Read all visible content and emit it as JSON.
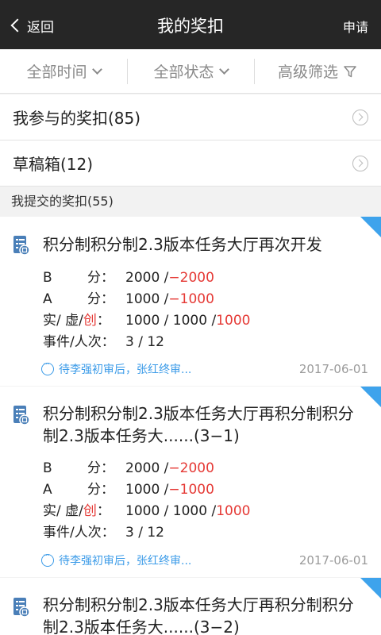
{
  "header": {
    "back_label": "返回",
    "title": "我的奖扣",
    "action_label": "申请"
  },
  "filters": [
    {
      "label": "全部时间"
    },
    {
      "label": "全部状态"
    },
    {
      "label": "高级筛选"
    }
  ],
  "rows": [
    {
      "label": "我参与的奖扣(85)"
    },
    {
      "label": "草稿箱(12)"
    }
  ],
  "section_title": "我提交的奖扣(55)",
  "cards": [
    {
      "title": "积分制积分制2.3版本任务大厅再次开发",
      "b_label": "B",
      "b_unit": "分：",
      "b_value": "2000 / ",
      "b_neg": "−2000",
      "a_label": "A",
      "a_unit": "分：",
      "a_value": "1000 / ",
      "a_neg": "−1000",
      "svc_label_1": "实/ 虚/ ",
      "svc_label_2": "创",
      "svc_label_3": "：",
      "svc_value": "1000 / 1000 / ",
      "svc_red": "1000",
      "event_label": "事件/人次：",
      "event_value": "3 / 12",
      "status": "待李强初审后，张红终审...",
      "date": "2017-06-01"
    },
    {
      "title": "积分制积分制2.3版本任务大厅再积分制积分制2.3版本任务大......(3−1)",
      "b_label": "B",
      "b_unit": "分：",
      "b_value": "2000 / ",
      "b_neg": "−2000",
      "a_label": "A",
      "a_unit": "分：",
      "a_value": "1000 / ",
      "a_neg": "−1000",
      "svc_label_1": "实/ 虚/ ",
      "svc_label_2": "创",
      "svc_label_3": "：",
      "svc_value": "1000 / 1000 / ",
      "svc_red": "1000",
      "event_label": "事件/人次：",
      "event_value": "3 / 12",
      "status": "待李强初审后，张红终审...",
      "date": "2017-06-01"
    },
    {
      "title": "积分制积分制2.3版本任务大厅再积分制积分制2.3版本任务大......(3−2)"
    }
  ]
}
